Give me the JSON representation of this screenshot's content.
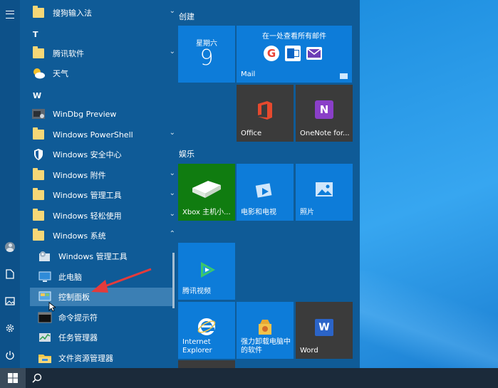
{
  "start": {
    "tiles_group1": "创建",
    "tiles_group2": "娱乐",
    "apps": {
      "sogou": "搜狗输入法",
      "letter_t": "T",
      "tencent": "腾讯软件",
      "weather": "天气",
      "letter_w": "W",
      "windbg": "WinDbg Preview",
      "powershell": "Windows PowerShell",
      "security": "Windows 安全中心",
      "accessories": "Windows 附件",
      "admin_tools": "Windows 管理工具",
      "ease": "Windows 轻松使用",
      "system": "Windows 系统",
      "sub_admin": "Windows 管理工具",
      "sub_pc": "此电脑",
      "sub_control": "控制面板",
      "sub_cmd": "命令提示符",
      "sub_taskmgr": "任务管理器",
      "sub_explorer": "文件资源管理器"
    },
    "tiles": {
      "calendar_day": "星期六",
      "calendar_date": "9",
      "mail_header": "在一处查看所有邮件",
      "mail_label": "Mail",
      "office": "Office",
      "onenote": "OneNote for...",
      "xbox": "Xbox 主机小...",
      "movies": "电影和电视",
      "photos": "照片",
      "tencent_video": "腾讯视频",
      "ie_line1": "Internet",
      "ie_line2": "Explorer",
      "uninstall_line1": "强力卸载电脑中",
      "uninstall_line2": "的软件",
      "word": "Word"
    }
  },
  "colors": {
    "accent": "#0d7cd9",
    "menu_bg": "#0f5b97",
    "arrow": "#e43b3b"
  }
}
